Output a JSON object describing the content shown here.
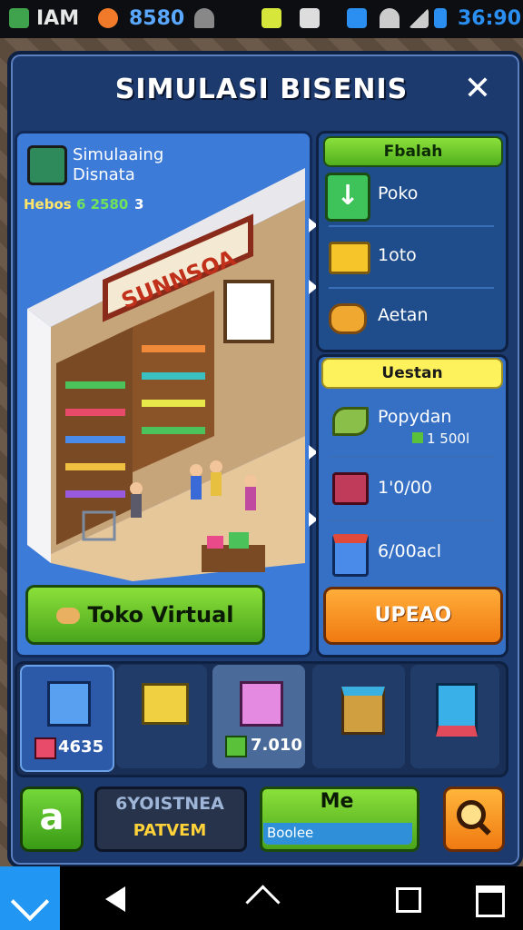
{
  "status_bar": {
    "carrier": "IAM",
    "app_text": "8580",
    "time": "36:90"
  },
  "panel": {
    "title": "SIMULASI BISENIS"
  },
  "business": {
    "name_line1": "Simulaaing",
    "name_line2": "Disnata",
    "stat_label": "Hebos",
    "stat_value": "6 2580",
    "stat_count": "3",
    "store_sign": "SUNNSOA"
  },
  "buttons": {
    "toko_virtual": "Toko Virtual",
    "upgrade": "UPEAO"
  },
  "right_menu": {
    "header": "Fbalah",
    "items": [
      {
        "label": "Poko",
        "icon": "arrow-down-icon"
      },
      {
        "label": "1oto",
        "icon": "gold-bars-icon"
      },
      {
        "label": "Aetan",
        "icon": "coins-icon"
      }
    ]
  },
  "upgrades": {
    "header": "Uestan",
    "items": [
      {
        "label": "Popydan",
        "value": "1 500l",
        "icon": "leaf-icon"
      },
      {
        "label": "1'0/00",
        "icon": "basket-icon"
      },
      {
        "label": "6/00acl",
        "icon": "crate-icon"
      }
    ]
  },
  "inventory": {
    "slots": [
      {
        "icon": "blue-box-icon",
        "value": "4635"
      },
      {
        "icon": "yellow-box-icon",
        "value": ""
      },
      {
        "icon": "pink-box-icon",
        "value": "7.010"
      },
      {
        "icon": "gift-box-icon",
        "value": ""
      },
      {
        "icon": "red-block-icon",
        "value": ""
      }
    ]
  },
  "controls": {
    "a_label": "a",
    "system_line1": "6YOISTNEA",
    "system_line2": "PATVEM",
    "me_label": "Me",
    "me_sub": "Boolee"
  },
  "colors": {
    "panel": "#1d3a6e",
    "scene": "#3d7bd8",
    "green_button": "#4aa51c",
    "orange_button": "#f07a12",
    "yellow_header": "#fdf25b"
  }
}
